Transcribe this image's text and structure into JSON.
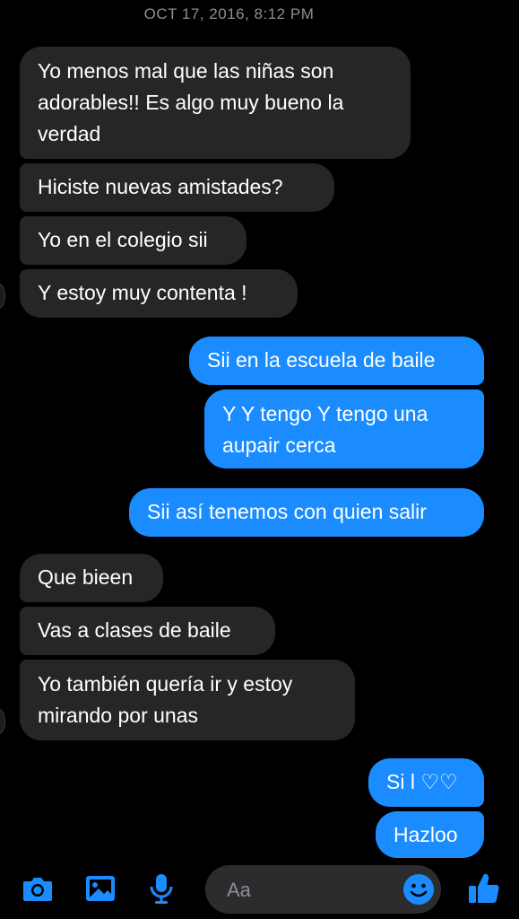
{
  "conversation": {
    "timestamp": "OCT 17, 2016, 8:12 PM",
    "messages": [
      {
        "sender": "them",
        "text": "Yo menos mal que las niñas son\nadorables!! Es algo muy bueno la\nverdad"
      },
      {
        "sender": "them",
        "text": "Hiciste nuevas amistades?"
      },
      {
        "sender": "them",
        "text": "Yo en el colegio sii"
      },
      {
        "sender": "them",
        "text": "Y estoy muy contenta !"
      },
      {
        "sender": "me",
        "text": "Sii en la escuela de baile"
      },
      {
        "sender": "me",
        "text": "Y Y tengo Y tengo una\naupair cerca"
      },
      {
        "sender": "me",
        "text": "Sii así tenemos con quien salir"
      },
      {
        "sender": "them",
        "text": "Que bieen"
      },
      {
        "sender": "them",
        "text": "Vas a clases de baile"
      },
      {
        "sender": "them",
        "text": "Yo también quería ir y estoy\nmirando por unas"
      },
      {
        "sender": "me",
        "text": "Si l ♡♡"
      },
      {
        "sender": "me",
        "text": "Hazloo"
      }
    ]
  },
  "composer": {
    "placeholder": "Aa",
    "icons": [
      "camera-icon",
      "photo-icon",
      "microphone-icon",
      "emoji-icon",
      "thumbs-up-icon"
    ]
  },
  "colors": {
    "background": "#000000",
    "incoming_bubble": "#262628",
    "outgoing_bubble": "#1a8cff",
    "accent": "#1a8cff",
    "timestamp": "#8e8e93"
  }
}
